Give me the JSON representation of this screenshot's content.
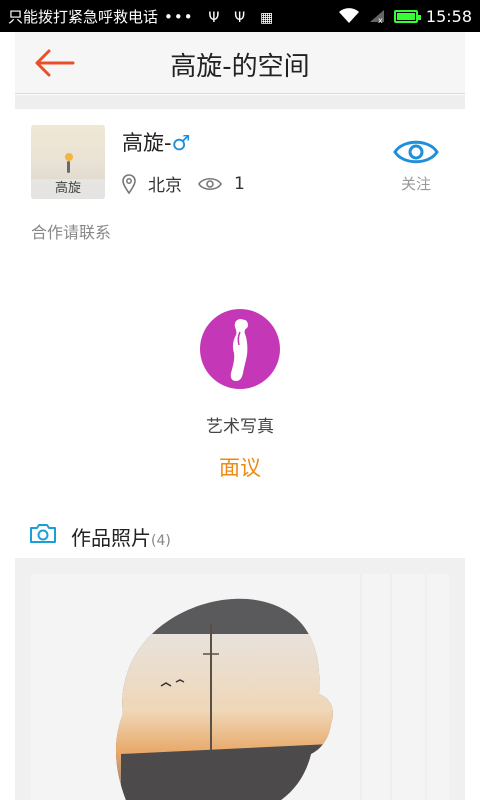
{
  "status_bar": {
    "notification_text": "只能拨打紧急呼救电话",
    "dots": "•••",
    "time": "15:58"
  },
  "header": {
    "title": "高旋-的空间",
    "accent_color": "#e8502a"
  },
  "profile": {
    "avatar_caption": "高旋",
    "name": "高旋-",
    "gender_symbol": "♂",
    "location": "北京",
    "views": "1",
    "follow_label": "关注",
    "contact_note": "合作请联系"
  },
  "service": {
    "category": "艺术写真",
    "price": "面议",
    "icon_color": "#c437b6",
    "price_color": "#ee8a12"
  },
  "works": {
    "label": "作品照片",
    "count": "(4)"
  }
}
